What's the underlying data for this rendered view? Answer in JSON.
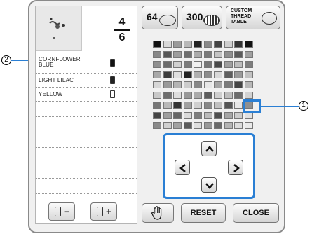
{
  "pattern_counter": {
    "current": "4",
    "total": "6"
  },
  "threads": [
    {
      "line1": "CORNFLOWER",
      "line2": "BLUE",
      "spool_fill": "#111111"
    },
    {
      "line1": "LIGHT LILAC",
      "line2": "",
      "spool_fill": "#222222"
    },
    {
      "line1": "YELLOW",
      "line2": "",
      "spool_fill": "#ffffff"
    }
  ],
  "top_buttons": {
    "palette64": "64",
    "palette300": "300",
    "custom_line1": "CUSTOM",
    "custom_line2": "THREAD",
    "custom_line3": "TABLE"
  },
  "buttons": {
    "reset": "RESET",
    "close": "CLOSE",
    "minus": "−",
    "plus": "+"
  },
  "callouts": {
    "one": "1",
    "two": "2"
  },
  "colors": {
    "accent": "#2a7fd4"
  },
  "palette_rows": [
    [
      "#111111",
      "#d8d8d8",
      "#9a9a9a",
      "#b8b8b8",
      "#222222",
      "#8a8a8a",
      "#444444",
      "#cfcfcf",
      "#333333",
      "#111111"
    ],
    [
      "#888888",
      "#555555",
      "#9c9c9c",
      "#6e6e6e",
      "#aaaaaa",
      "#7a7a7a",
      "#c4c4c4",
      "#909090",
      "#5a5a5a",
      "#a0a0a0"
    ],
    [
      "#8f8f8f",
      "#6a6a6a",
      "#d0d0d0",
      "#7c7c7c",
      "#f2f2f2",
      "#777777",
      "#4a4a4a",
      "#9e9e9e",
      "#bcbcbc",
      "#7e7e7e"
    ],
    [
      "#a8a8a8",
      "#3c3c3c",
      "#e0e0e0",
      "#222222",
      "#b0b0b0",
      "#8c8c8c",
      "#d8d8d8",
      "#5e5e5e",
      "#9a9a9a",
      "#c2c2c2"
    ],
    [
      "#d6d6d6",
      "#9a9a9a",
      "#b4b4b4",
      "#cccccc",
      "#888888",
      "#e6e6e6",
      "#a4a4a4",
      "#7a7a7a",
      "#444444",
      "#b8b8b8"
    ],
    [
      "#c8c8c8",
      "#6e6e6e",
      "#dddddd",
      "#999999",
      "#aaaaaa",
      "#5c5c5c",
      "#cfcfcf",
      "#bdbdbd",
      "#6c6c6c",
      "#d2d2d2"
    ],
    [
      "#777777",
      "#b8b8b8",
      "#333333",
      "#a0a0a0",
      "#d0d0d0",
      "#888888",
      "#c0c0c0",
      "#555555",
      "#e8e8e8",
      "#909090"
    ],
    [
      "#444444",
      "#9e9e9e",
      "#666666",
      "#dadada",
      "#7e7e7e",
      "#bbbbbb",
      "#4e4e4e",
      "#a6a6a6",
      "#cccccc",
      "#e0e0e0"
    ],
    [
      "#8a8a8a",
      "#cfcfcf",
      "#a2a2a2",
      "#5a5a5a",
      "#dedede",
      "#999999",
      "#6a6a6a",
      "#b4b4b4",
      "#dcdcdc",
      "#eaeaea"
    ]
  ],
  "icons": [
    "spool-icon",
    "pattern-preview-icon",
    "palette-64-icon",
    "palette-300-icon",
    "custom-table-icon",
    "hand-icon",
    "arrow-up-icon",
    "arrow-down-icon",
    "arrow-left-icon",
    "arrow-right-icon"
  ]
}
